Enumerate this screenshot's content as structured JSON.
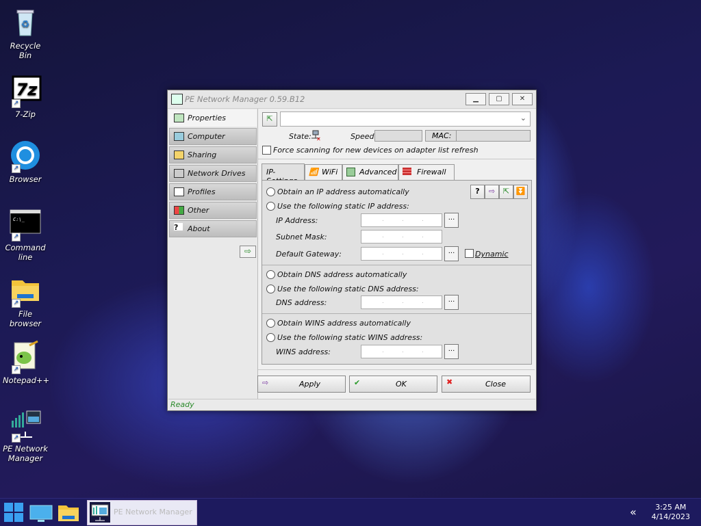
{
  "desktop": {
    "icons": [
      {
        "label": "Recycle Bin"
      },
      {
        "label": "7-Zip"
      },
      {
        "label": "Browser"
      },
      {
        "label": "Command line"
      },
      {
        "label": "File browser"
      },
      {
        "label": "Notepad++"
      },
      {
        "label": "PE Network Manager"
      }
    ]
  },
  "window": {
    "title": "PE Network Manager 0.59.B12",
    "sidebar": {
      "items": [
        {
          "label": "Properties"
        },
        {
          "label": "Computer"
        },
        {
          "label": "Sharing"
        },
        {
          "label": "Network Drives"
        },
        {
          "label": "Profiles"
        },
        {
          "label": "Other"
        },
        {
          "label": "About"
        }
      ]
    },
    "adapter": {
      "selected": ""
    },
    "state_label": "State:",
    "speed_label": "Speed:",
    "speed_value": "",
    "mac_label": "MAC:",
    "mac_value": "",
    "force_scan_label": "Force scanning for new devices on adapter list refresh",
    "tabs": [
      {
        "label": "IP-Settings"
      },
      {
        "label": "WiFi"
      },
      {
        "label": "Advanced"
      },
      {
        "label": "Firewall"
      }
    ],
    "ip": {
      "auto_ip": "Obtain an IP address automatically",
      "static_ip": "Use the following static IP address:",
      "ip_address_label": "IP Address:",
      "subnet_label": "Subnet Mask:",
      "gateway_label": "Default Gateway:",
      "dynamic_label": "Dynamic",
      "auto_dns": "Obtain DNS address automatically",
      "static_dns": "Use the following static DNS address:",
      "dns_label": "DNS address:",
      "auto_wins": "Obtain WINS address automatically",
      "static_wins": "Use the following static WINS address:",
      "wins_label": "WINS address:",
      "dots_button": "..."
    },
    "buttons": {
      "apply": "Apply",
      "ok": "OK",
      "close": "Close"
    },
    "status": "Ready"
  },
  "taskbar": {
    "active_app": "PE Network Manager",
    "time": "3:25 AM",
    "date": "4/14/2023",
    "chevron": "«"
  }
}
